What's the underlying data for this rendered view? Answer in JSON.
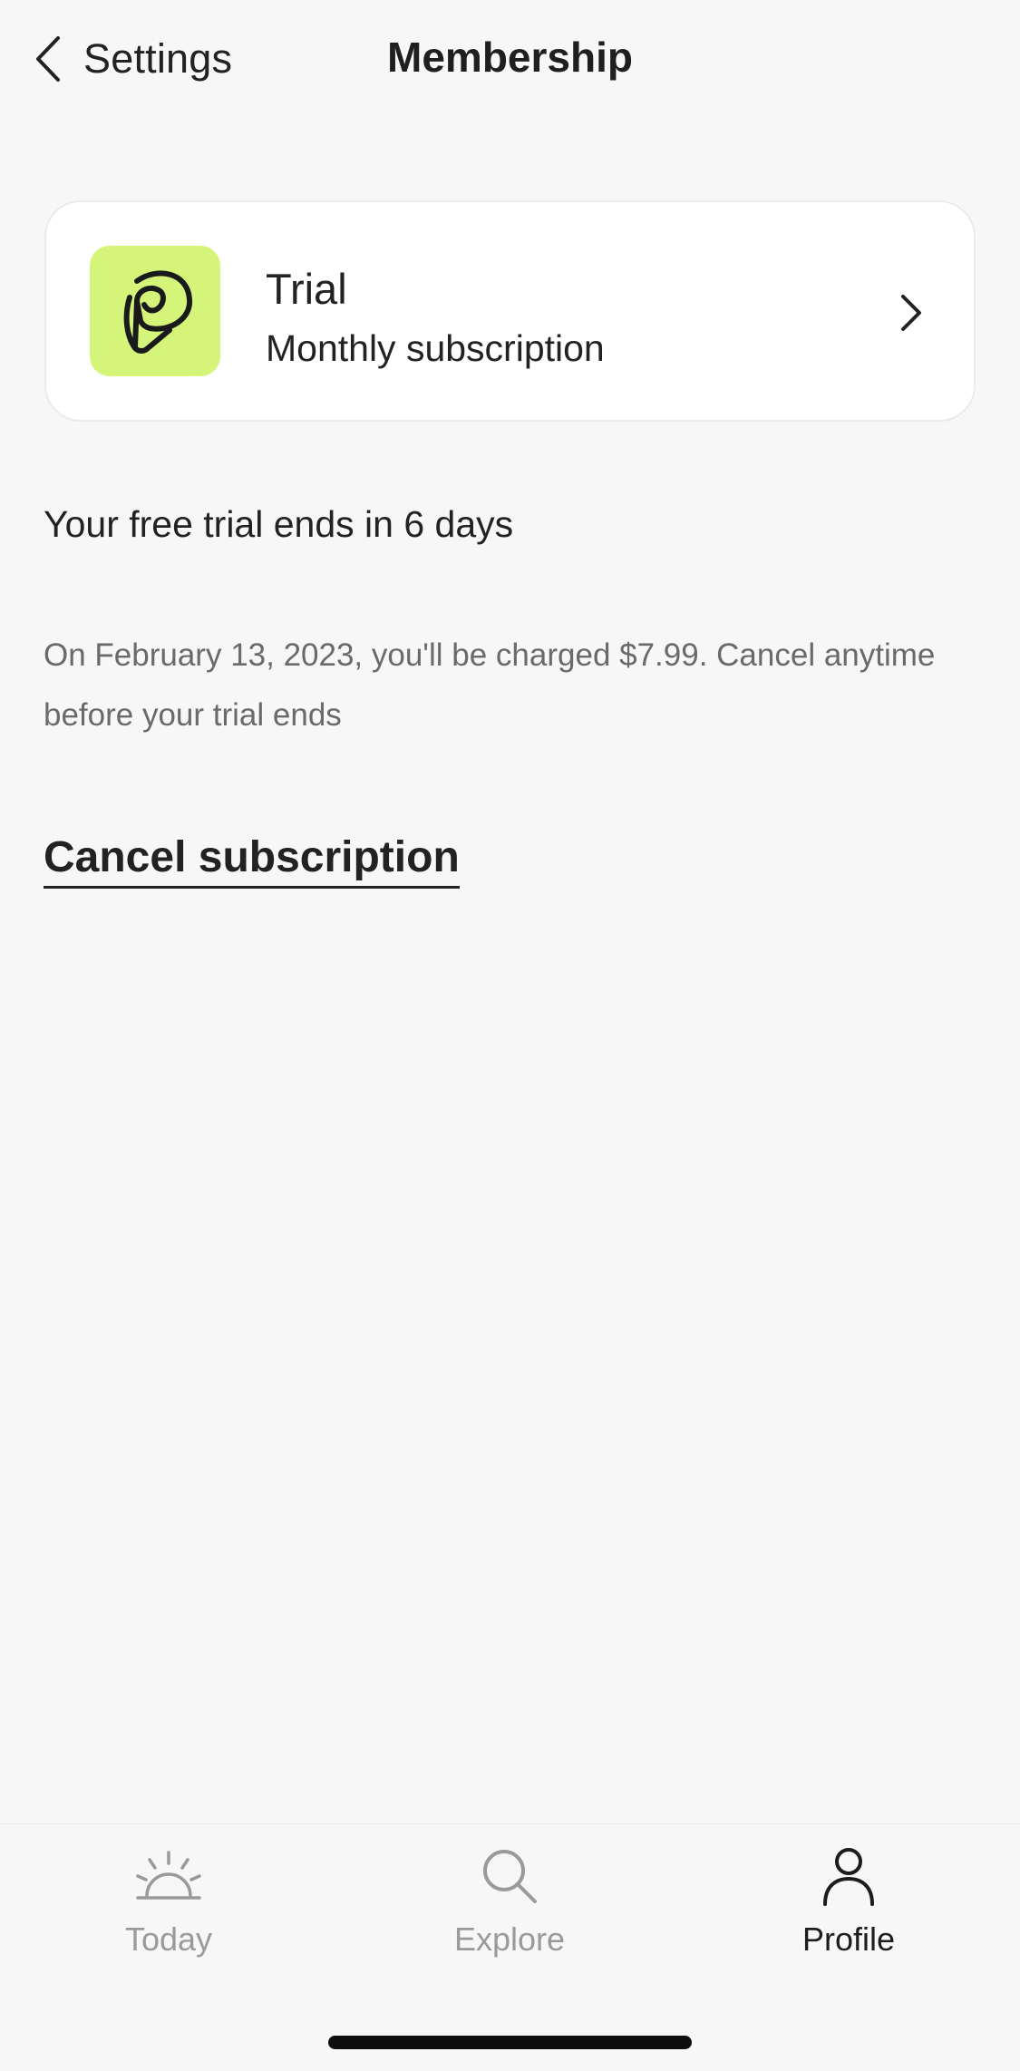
{
  "nav": {
    "back_label": "Settings",
    "title": "Membership"
  },
  "plan": {
    "name": "Trial",
    "subtitle": "Monthly subscription",
    "logo_color": "#d4f57a"
  },
  "trial": {
    "heading": "Your free trial ends in 6 days",
    "detail": "On February 13, 2023, you'll be charged $7.99. Cancel anytime before your trial ends"
  },
  "actions": {
    "cancel_label": "Cancel subscription"
  },
  "tabbar": {
    "tabs": [
      {
        "label": "Today",
        "icon": "sunrise-icon",
        "active": false
      },
      {
        "label": "Explore",
        "icon": "search-icon",
        "active": false
      },
      {
        "label": "Profile",
        "icon": "person-icon",
        "active": true
      }
    ]
  },
  "colors": {
    "background": "#f7f7f7",
    "accent": "#d4f57a",
    "text": "#222222",
    "muted": "#6a6a6a",
    "inactive_tab": "#9a9a9a"
  }
}
